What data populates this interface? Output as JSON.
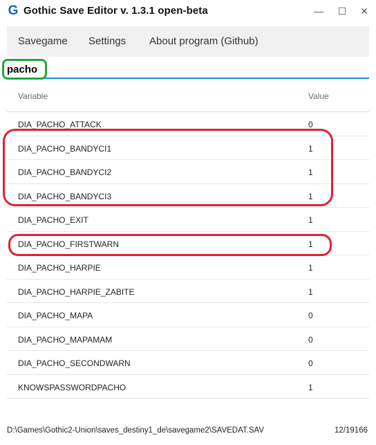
{
  "window": {
    "app_icon": "G",
    "title": "Gothic Save Editor v. 1.3.1 open-beta",
    "minimize": "—",
    "maximize": "☐",
    "close": "✕"
  },
  "menu": {
    "items": [
      "Savegame",
      "Settings",
      "About program (Github)"
    ]
  },
  "search": {
    "value": "pacho"
  },
  "table": {
    "headers": {
      "variable": "Variable",
      "value": "Value"
    },
    "rows": [
      {
        "variable": "DIA_PACHO_ATTACK",
        "value": "0"
      },
      {
        "variable": "DIA_PACHO_BANDYCI1",
        "value": "1"
      },
      {
        "variable": "DIA_PACHO_BANDYCI2",
        "value": "1"
      },
      {
        "variable": "DIA_PACHO_BANDYCI3",
        "value": "1"
      },
      {
        "variable": "DIA_PACHO_EXIT",
        "value": "1"
      },
      {
        "variable": "DIA_PACHO_FIRSTWARN",
        "value": "1"
      },
      {
        "variable": "DIA_PACHO_HARPIE",
        "value": "1"
      },
      {
        "variable": "DIA_PACHO_HARPIE_ZABITE",
        "value": "1"
      },
      {
        "variable": "DIA_PACHO_MAPA",
        "value": "0"
      },
      {
        "variable": "DIA_PACHO_MAPAMAM",
        "value": "0"
      },
      {
        "variable": "DIA_PACHO_SECONDWARN",
        "value": "0"
      },
      {
        "variable": "KNOWSPASSWORDPACHO",
        "value": "1"
      }
    ]
  },
  "status": {
    "path": "D:\\Games\\Gothic2-Union\\saves_destiny1_de\\savegame2\\SAVEDAT.SAV",
    "count": "12/19166"
  },
  "colors": {
    "accent": "#1e88e5",
    "icon": "#1565c0",
    "annotation_green": "#1da83d",
    "annotation_red": "#e02030"
  }
}
